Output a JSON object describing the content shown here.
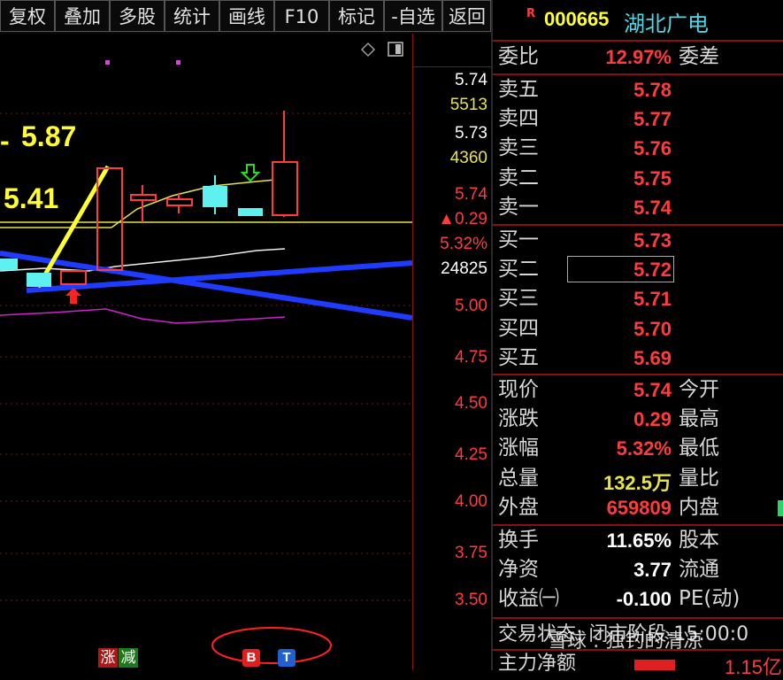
{
  "toolbar": {
    "buttons": [
      "复权",
      "叠加",
      "多股",
      "统计",
      "画线",
      "F10",
      "标记",
      "-自选",
      "返回"
    ]
  },
  "chart": {
    "annotations": {
      "high_price": "5.87",
      "low_price": "5.41"
    },
    "axis_info": {
      "price1": "5.74",
      "volume1": "5513",
      "price2": "5.73",
      "volume2": "4360",
      "price3": "5.74",
      "change": "▲0.29",
      "change_pct": "5.32%",
      "volume3": "24825"
    },
    "price_ticks": [
      "5.00",
      "4.75",
      "4.50",
      "4.25",
      "4.00",
      "3.75",
      "3.50"
    ],
    "bottom_badges": {
      "zhang": "涨",
      "jian": "减",
      "b": "B",
      "t": "T"
    }
  },
  "quote": {
    "r_badge": "R",
    "code": "000665",
    "name": "湖北广电",
    "weibi_label": "委比",
    "weibi_value": "12.97%",
    "weicha_label": "委差",
    "sell": [
      {
        "label": "卖五",
        "price": "5.78"
      },
      {
        "label": "卖四",
        "price": "5.77"
      },
      {
        "label": "卖三",
        "price": "5.76"
      },
      {
        "label": "卖二",
        "price": "5.75"
      },
      {
        "label": "卖一",
        "price": "5.74"
      }
    ],
    "buy": [
      {
        "label": "买一",
        "price": "5.73"
      },
      {
        "label": "买二",
        "price": "5.72"
      },
      {
        "label": "买三",
        "price": "5.71"
      },
      {
        "label": "买四",
        "price": "5.70"
      },
      {
        "label": "买五",
        "price": "5.69"
      }
    ],
    "stats": [
      {
        "label": "现价",
        "value": "5.74",
        "label2": "今开"
      },
      {
        "label": "涨跌",
        "value": "0.29",
        "label2": "最高"
      },
      {
        "label": "涨幅",
        "value": "5.32%",
        "label2": "最低"
      },
      {
        "label": "总量",
        "value": "132.5万",
        "label2": "量比"
      },
      {
        "label": "外盘",
        "value": "659809",
        "label2": "内盘"
      }
    ],
    "fundamentals": [
      {
        "label": "换手",
        "value": "11.65%",
        "label2": "股本"
      },
      {
        "label": "净资",
        "value": "3.77",
        "label2": "流通"
      },
      {
        "label": "收益㈠",
        "value": "-0.100",
        "label2": "PE(动)"
      }
    ],
    "trade_status": "交易状态: 闭市阶段-15:00:0",
    "main_fund_label": "主力净额",
    "main_fund_value": "1.15亿",
    "watermark": "雪球 : 独钓的清凉",
    "colors": {
      "up": "#ff3b3b",
      "down": "#2fd16a",
      "volume": "#e8e34b"
    }
  }
}
